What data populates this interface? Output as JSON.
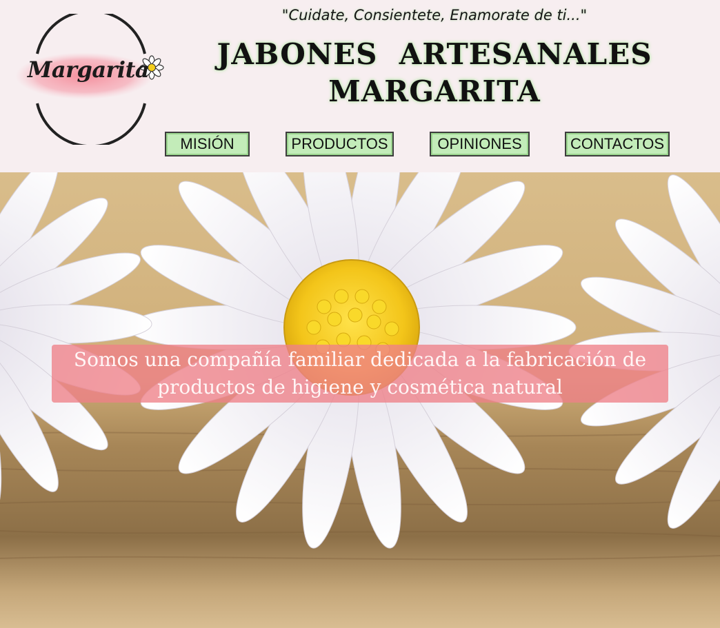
{
  "header": {
    "logo_text": "Margarita",
    "logo_icon": "daisy-icon",
    "slogan": "\"Cuidate, Consientete, Enamorate de ti...\"",
    "title_line1": "JABONES  ARTESANALES",
    "title_line2": "MARGARITA"
  },
  "nav": {
    "items": [
      {
        "label": "MISIÓN"
      },
      {
        "label": "PRODUCTOS"
      },
      {
        "label": "OPINIONES"
      },
      {
        "label": "CONTACTOS"
      }
    ]
  },
  "hero": {
    "image": "daisies-on-wood-photo",
    "banner_text": "Somos una compañía familiar dedicada a la fabricación de productos de higiene y cosmética natural"
  },
  "colors": {
    "page_bg": "#f7eef0",
    "nav_bg": "#c3ecb9",
    "banner_bg": "#ee8088",
    "daisy_center": "#f4cf1c"
  }
}
